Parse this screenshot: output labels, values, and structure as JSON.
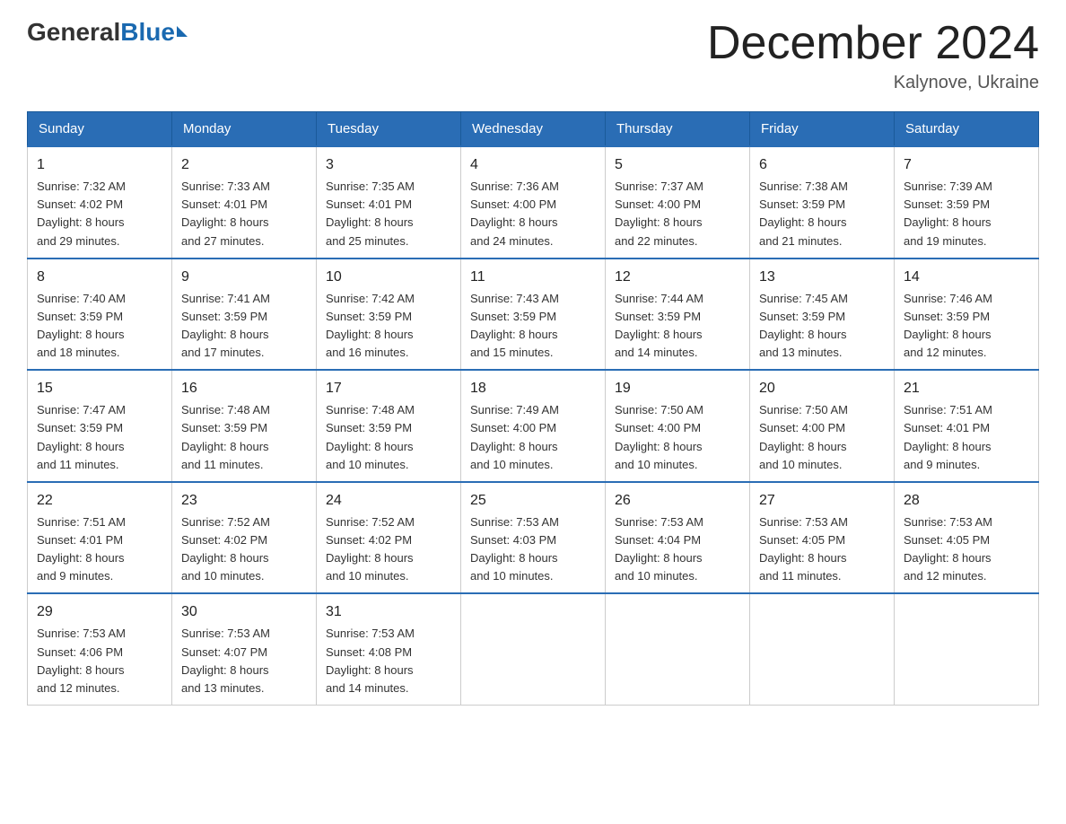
{
  "header": {
    "logo_general": "General",
    "logo_blue": "Blue",
    "month_title": "December 2024",
    "location": "Kalynove, Ukraine"
  },
  "days_of_week": [
    "Sunday",
    "Monday",
    "Tuesday",
    "Wednesday",
    "Thursday",
    "Friday",
    "Saturday"
  ],
  "weeks": [
    [
      {
        "day": "1",
        "sunrise": "7:32 AM",
        "sunset": "4:02 PM",
        "daylight": "8 hours and 29 minutes."
      },
      {
        "day": "2",
        "sunrise": "7:33 AM",
        "sunset": "4:01 PM",
        "daylight": "8 hours and 27 minutes."
      },
      {
        "day": "3",
        "sunrise": "7:35 AM",
        "sunset": "4:01 PM",
        "daylight": "8 hours and 25 minutes."
      },
      {
        "day": "4",
        "sunrise": "7:36 AM",
        "sunset": "4:00 PM",
        "daylight": "8 hours and 24 minutes."
      },
      {
        "day": "5",
        "sunrise": "7:37 AM",
        "sunset": "4:00 PM",
        "daylight": "8 hours and 22 minutes."
      },
      {
        "day": "6",
        "sunrise": "7:38 AM",
        "sunset": "3:59 PM",
        "daylight": "8 hours and 21 minutes."
      },
      {
        "day": "7",
        "sunrise": "7:39 AM",
        "sunset": "3:59 PM",
        "daylight": "8 hours and 19 minutes."
      }
    ],
    [
      {
        "day": "8",
        "sunrise": "7:40 AM",
        "sunset": "3:59 PM",
        "daylight": "8 hours and 18 minutes."
      },
      {
        "day": "9",
        "sunrise": "7:41 AM",
        "sunset": "3:59 PM",
        "daylight": "8 hours and 17 minutes."
      },
      {
        "day": "10",
        "sunrise": "7:42 AM",
        "sunset": "3:59 PM",
        "daylight": "8 hours and 16 minutes."
      },
      {
        "day": "11",
        "sunrise": "7:43 AM",
        "sunset": "3:59 PM",
        "daylight": "8 hours and 15 minutes."
      },
      {
        "day": "12",
        "sunrise": "7:44 AM",
        "sunset": "3:59 PM",
        "daylight": "8 hours and 14 minutes."
      },
      {
        "day": "13",
        "sunrise": "7:45 AM",
        "sunset": "3:59 PM",
        "daylight": "8 hours and 13 minutes."
      },
      {
        "day": "14",
        "sunrise": "7:46 AM",
        "sunset": "3:59 PM",
        "daylight": "8 hours and 12 minutes."
      }
    ],
    [
      {
        "day": "15",
        "sunrise": "7:47 AM",
        "sunset": "3:59 PM",
        "daylight": "8 hours and 11 minutes."
      },
      {
        "day": "16",
        "sunrise": "7:48 AM",
        "sunset": "3:59 PM",
        "daylight": "8 hours and 11 minutes."
      },
      {
        "day": "17",
        "sunrise": "7:48 AM",
        "sunset": "3:59 PM",
        "daylight": "8 hours and 10 minutes."
      },
      {
        "day": "18",
        "sunrise": "7:49 AM",
        "sunset": "4:00 PM",
        "daylight": "8 hours and 10 minutes."
      },
      {
        "day": "19",
        "sunrise": "7:50 AM",
        "sunset": "4:00 PM",
        "daylight": "8 hours and 10 minutes."
      },
      {
        "day": "20",
        "sunrise": "7:50 AM",
        "sunset": "4:00 PM",
        "daylight": "8 hours and 10 minutes."
      },
      {
        "day": "21",
        "sunrise": "7:51 AM",
        "sunset": "4:01 PM",
        "daylight": "8 hours and 9 minutes."
      }
    ],
    [
      {
        "day": "22",
        "sunrise": "7:51 AM",
        "sunset": "4:01 PM",
        "daylight": "8 hours and 9 minutes."
      },
      {
        "day": "23",
        "sunrise": "7:52 AM",
        "sunset": "4:02 PM",
        "daylight": "8 hours and 10 minutes."
      },
      {
        "day": "24",
        "sunrise": "7:52 AM",
        "sunset": "4:02 PM",
        "daylight": "8 hours and 10 minutes."
      },
      {
        "day": "25",
        "sunrise": "7:53 AM",
        "sunset": "4:03 PM",
        "daylight": "8 hours and 10 minutes."
      },
      {
        "day": "26",
        "sunrise": "7:53 AM",
        "sunset": "4:04 PM",
        "daylight": "8 hours and 10 minutes."
      },
      {
        "day": "27",
        "sunrise": "7:53 AM",
        "sunset": "4:05 PM",
        "daylight": "8 hours and 11 minutes."
      },
      {
        "day": "28",
        "sunrise": "7:53 AM",
        "sunset": "4:05 PM",
        "daylight": "8 hours and 12 minutes."
      }
    ],
    [
      {
        "day": "29",
        "sunrise": "7:53 AM",
        "sunset": "4:06 PM",
        "daylight": "8 hours and 12 minutes."
      },
      {
        "day": "30",
        "sunrise": "7:53 AM",
        "sunset": "4:07 PM",
        "daylight": "8 hours and 13 minutes."
      },
      {
        "day": "31",
        "sunrise": "7:53 AM",
        "sunset": "4:08 PM",
        "daylight": "8 hours and 14 minutes."
      },
      null,
      null,
      null,
      null
    ]
  ],
  "labels": {
    "sunrise": "Sunrise:",
    "sunset": "Sunset:",
    "daylight": "Daylight:"
  }
}
